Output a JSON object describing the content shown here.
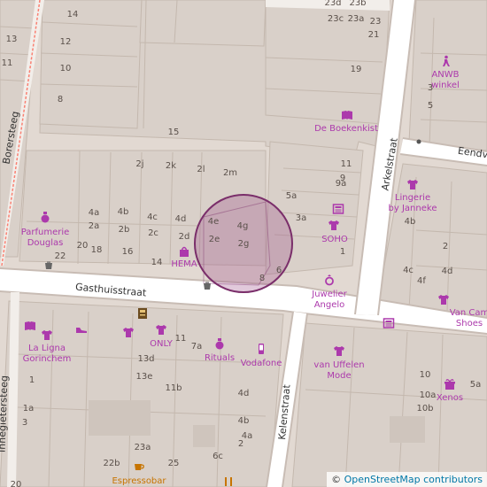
{
  "map": {
    "colors": {
      "road": "#ffffff",
      "road_edge": "#c8bcb4",
      "building": "#d9d0c9",
      "building_edge": "#c4b8ae",
      "poi": "#ac39ac",
      "food": "#c77400",
      "footway": "#fa8072",
      "highlight_fill": "#9b4d87",
      "highlight_stroke": "#7a2e6a"
    },
    "streets": {
      "gasthuisstraat": "Gasthuisstraat",
      "borersteeg": "Borersteeg",
      "arkelstraat": "Arkelstraat",
      "eendv": "Eendv",
      "kelenstraat": "Kelenstraat",
      "innegietersteeg": "Innegietersteeg"
    },
    "pois": {
      "boekenkist": "De Boekenkist",
      "anwb": "ANWB\nwinkel",
      "parfumerie": "Parfumerie\nDouglas",
      "hema": "HEMA",
      "soho": "SOHO",
      "lingerie": "Lingerie\nby Janneke",
      "juwelier": "Juwelier\nAngelo",
      "la_ligna": "La Ligna\nGorinchem",
      "only": "ONLY",
      "rituals": "Rituals",
      "vodafone": "Vodafone",
      "van_uffelen": "van Uffelen\nMode",
      "xenos": "Xenos",
      "van_cam": "Van Cam\nShoes",
      "espressobar": "Espressobar"
    },
    "icons": {
      "boekenkist": "book-icon",
      "anwb": "hiker-icon",
      "parfumerie": "perfume-icon",
      "hema": "shopping-bag-icon",
      "soho": "shirt-icon",
      "lingerie": "shirt-icon",
      "juwelier": "ring-icon",
      "la_ligna_book": "book-icon",
      "la_ligna_shirt": "shirt-icon",
      "shoe": "shoe-icon",
      "shirt_mid": "shirt-icon",
      "only": "shirt-icon",
      "rituals": "perfume-icon",
      "vodafone": "mobile-phone-icon",
      "van_uffelen": "shirt-icon",
      "xenos": "gift-icon",
      "van_cam": "shirt-icon",
      "espressobar": "coffee-icon",
      "waste_basket_1": "waste-basket-icon",
      "waste_basket_2": "waste-basket-icon",
      "newspaper_1": "newspaper-icon",
      "newspaper_2": "newspaper-icon",
      "atm": "atm-icon"
    },
    "house_numbers": [
      "14",
      "13",
      "11",
      "12",
      "10",
      "8",
      "23d",
      "23b",
      "23c",
      "23a",
      "23",
      "21",
      "19",
      "15",
      "2j",
      "2k",
      "2l",
      "2m",
      "11",
      "9",
      "9a",
      "5a",
      "3a",
      "4a",
      "4b",
      "4c",
      "4d",
      "4e",
      "4g",
      "2a",
      "2b",
      "2c",
      "2d",
      "2e",
      "2g",
      "20",
      "18",
      "16",
      "14",
      "22",
      "8",
      "6",
      "1",
      "5",
      "3",
      "4b",
      "4c",
      "4f",
      "4d",
      "2",
      "11",
      "13d",
      "13e",
      "11b",
      "7a",
      "4d",
      "4b",
      "4a",
      "1a",
      "3",
      "1",
      "22b",
      "23a",
      "25",
      "6c",
      "2",
      "10",
      "10a",
      "10b",
      "5a",
      "20"
    ],
    "attribution": {
      "symbol": "©",
      "text": "OpenStreetMap contributors"
    }
  }
}
